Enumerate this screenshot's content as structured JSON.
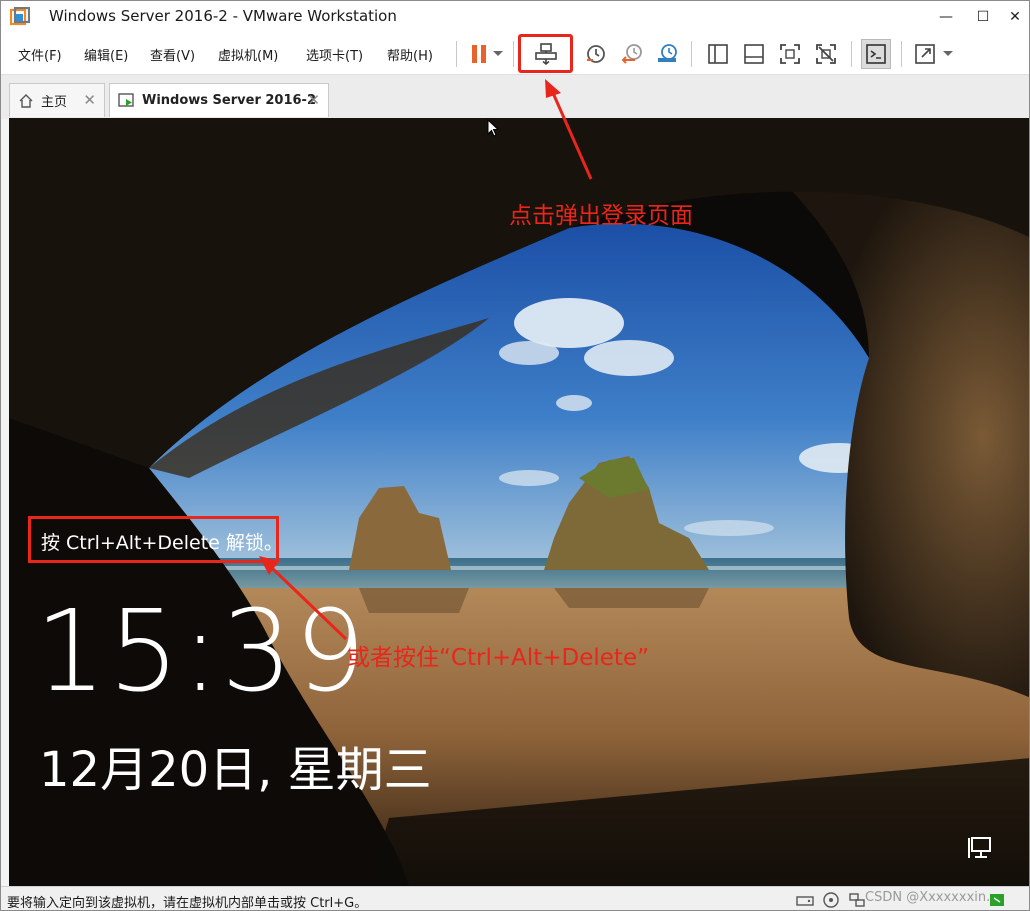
{
  "window": {
    "title": "Windows Server 2016-2 - VMware Workstation",
    "controls": {
      "minimize": "—",
      "maximize": "☐",
      "close": "✕"
    }
  },
  "menu": {
    "items": [
      "文件(F)",
      "编辑(E)",
      "查看(V)",
      "虚拟机(M)",
      "选项卡(T)",
      "帮助(H)"
    ]
  },
  "toolbar": {
    "icons": [
      "pause-icon",
      "dropdown-icon",
      "send-ctrl-alt-del-icon",
      "snapshot-icon",
      "revert-snapshot-icon",
      "snapshot-manager-icon",
      "view-split-left-icon",
      "view-split-bottom-icon",
      "fullscreen-icon",
      "unity-icon",
      "console-icon",
      "stretch-icon"
    ]
  },
  "tabs": [
    {
      "label": "主页",
      "icon": "home-icon"
    },
    {
      "label": "Windows Server 2016-2",
      "icon": "vm-icon",
      "active": true
    }
  ],
  "lockscreen": {
    "unlock_hint": "按 Ctrl+Alt+Delete 解锁。",
    "time": "15:39",
    "date": "12月20日, 星期三"
  },
  "annotations": {
    "toolbar_note": "点击弹出登录页面",
    "keyboard_note": "或者按住“Ctrl+Alt+Delete”"
  },
  "statusbar": {
    "text": "要将输入定向到该虚拟机，请在虚拟机内部单击或按 Ctrl+G。",
    "watermark": "CSDN @Xxxxxxxin."
  },
  "colors": {
    "accent_red": "#e8261b",
    "pause_orange": "#e8622a"
  }
}
